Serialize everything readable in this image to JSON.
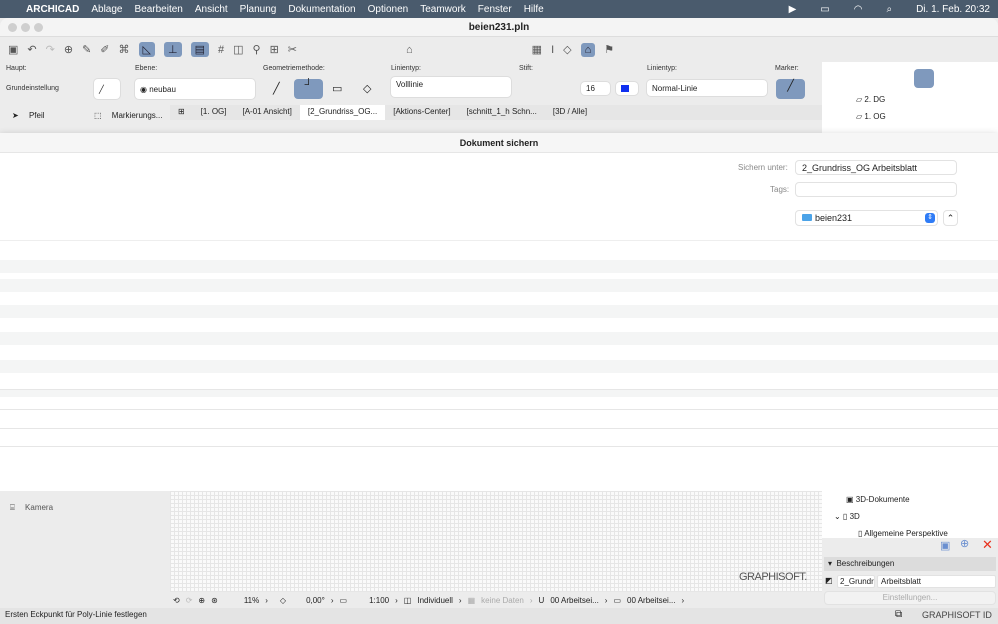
{
  "menubar": {
    "app": "ARCHICAD",
    "items": [
      "Ablage",
      "Bearbeiten",
      "Ansicht",
      "Planung",
      "Dokumentation",
      "Optionen",
      "Teamwork",
      "Fenster",
      "Hilfe"
    ],
    "clock": "Di. 1. Feb.  20:32"
  },
  "window": {
    "title": "beien231.pln"
  },
  "infobox": {
    "haupt_label": "Haupt:",
    "haupt_value": "Grundeinstellung",
    "ebene_label": "Ebene:",
    "ebene_value": "neubau",
    "geom_label": "Geometriemethode:",
    "linientyp_label": "Linientyp:",
    "linientyp_value": "Volllinie",
    "stift_label": "Stift:",
    "stift_value": "16",
    "linientyp2_label": "Linientyp:",
    "linientyp2_value": "Normal-Linie",
    "marker_label": "Marker:"
  },
  "toolbox": {
    "pfeil": "Pfeil",
    "markierung": "Markierungs...",
    "kamera": "Kamera"
  },
  "tabs": [
    "[1. OG]",
    "[A-01 Ansicht]",
    "[2_Grundriss_OG...",
    "[Aktions-Center]",
    "[schnitt_1_h Schn...",
    "[3D / Alle]"
  ],
  "navigator": {
    "items": [
      "2. DG",
      "1. OG"
    ],
    "lower": [
      "3D-Dokumente",
      "3D",
      "Allgemeine Perspektive"
    ]
  },
  "dialog": {
    "title": "Dokument sichern",
    "save_as_label": "Sichern unter:",
    "save_as_value": "2_Grundriss_OG Arbeitsblatt",
    "tags_label": "Tags:",
    "tags_value": "",
    "folder": "beien231"
  },
  "status": {
    "zoom": "11%",
    "angle": "0,00°",
    "scale": "1:100",
    "layer_combo": "Individuell",
    "nodata": "keine Daten",
    "pen": "00 Arbeitsei...",
    "view": "00 Arbeitsei..."
  },
  "rightpanel": {
    "section": "Beschreibungen",
    "id": "2_Grundr",
    "name": "Arbeitsblatt",
    "settings": "Einstellungen..."
  },
  "bottom": {
    "message": "Ersten Eckpunkt für Poly-Linie festlegen",
    "brand": "GRAPHISOFT ID",
    "watermark": "GRAPHISOFT."
  },
  "colors": {
    "menubar": "#4a5b6d",
    "selected": "#7f99bd",
    "accent": "#2f7cf6",
    "close": "#e8321e"
  }
}
